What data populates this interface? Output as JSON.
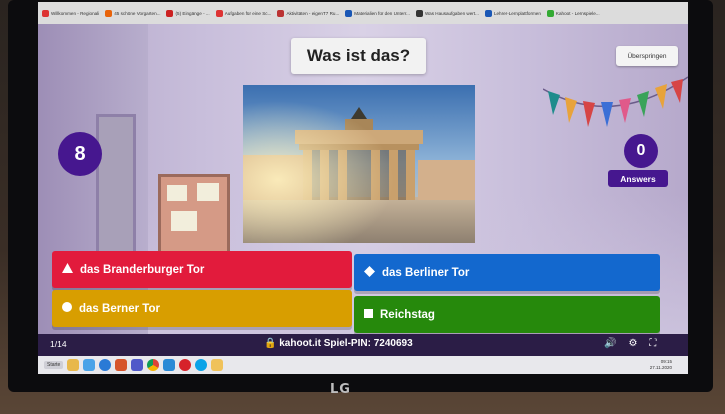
{
  "browser": {
    "bookmarks": [
      {
        "label": "Willkommen - Regionali",
        "color": "#d33"
      },
      {
        "label": "45 schöne Vorgarten...",
        "color": "#e8630a"
      },
      {
        "label": "(5) Eingänge - ...",
        "color": "#c22"
      },
      {
        "label": "Aufgaben für eine Sc...",
        "color": "#d33"
      },
      {
        "label": "Aktivitäten - eigenT7 Ru...",
        "color": "#b33"
      },
      {
        "label": "Materialien für den Unterr...",
        "color": "#1a57b5"
      },
      {
        "label": "Was Hausaufgaben wert...",
        "color": "#333"
      },
      {
        "label": "Lehrer-Lernplattformen",
        "color": "#1a57b5"
      },
      {
        "label": "Kahoot - Lernspiele...",
        "color": "#3a3"
      }
    ]
  },
  "game": {
    "question": "Was ist das?",
    "skip_label": "Überspringen",
    "timer": "8",
    "answers_count": "0",
    "answers_label": "Answers",
    "answer_options": [
      {
        "label": "das Branderburger Tor",
        "color": "#e21b3c",
        "shape": "triangle-icon"
      },
      {
        "label": "das Berliner Tor",
        "color": "#1368ce",
        "shape": "diamond-icon"
      },
      {
        "label": "das Berner Tor",
        "color": "#d89e00",
        "shape": "circle-icon"
      },
      {
        "label": "Reichstag",
        "color": "#26890c",
        "shape": "square-icon"
      }
    ]
  },
  "footer": {
    "question_counter": "1/14",
    "site": "kahoot.it",
    "pin_label": "Spiel-PIN:",
    "pin_value": "7240693"
  },
  "taskbar": {
    "start_label": "Starte",
    "time": "09:15",
    "date": "27.11.2020"
  },
  "monitor": {
    "brand": "LG"
  }
}
